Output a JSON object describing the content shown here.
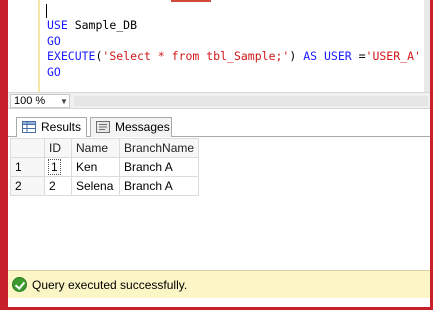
{
  "editor": {
    "line1_kw": "USE",
    "line1_rest": " Sample_DB",
    "line2": "GO",
    "line3_kw1": "EXECUTE",
    "line3_p1": "(",
    "line3_str1": "'Select * from tbl_Sample;'",
    "line3_p2": ") ",
    "line3_kw2": "AS USER",
    "line3_p3": " =",
    "line3_str2": "'USER_A'",
    "line4": "GO"
  },
  "zoom": {
    "value": "100 %"
  },
  "tabs": [
    {
      "label": "Results",
      "icon": "grid-icon",
      "active": true
    },
    {
      "label": "Messages",
      "icon": "messages-icon",
      "active": false
    }
  ],
  "grid": {
    "columns": [
      "ID",
      "Name",
      "BranchName"
    ],
    "rows": [
      {
        "num": "1",
        "cells": [
          "1",
          "Ken",
          "Branch A"
        ]
      },
      {
        "num": "2",
        "cells": [
          "2",
          "Selena",
          "Branch A"
        ]
      }
    ]
  },
  "status": {
    "text": "Query executed successfully.",
    "icon": "check-circle-icon",
    "color": "#fcf6c6"
  },
  "colors": {
    "keyword": "#1a1aff",
    "string": "#d01818",
    "frame": "#c8202a"
  }
}
